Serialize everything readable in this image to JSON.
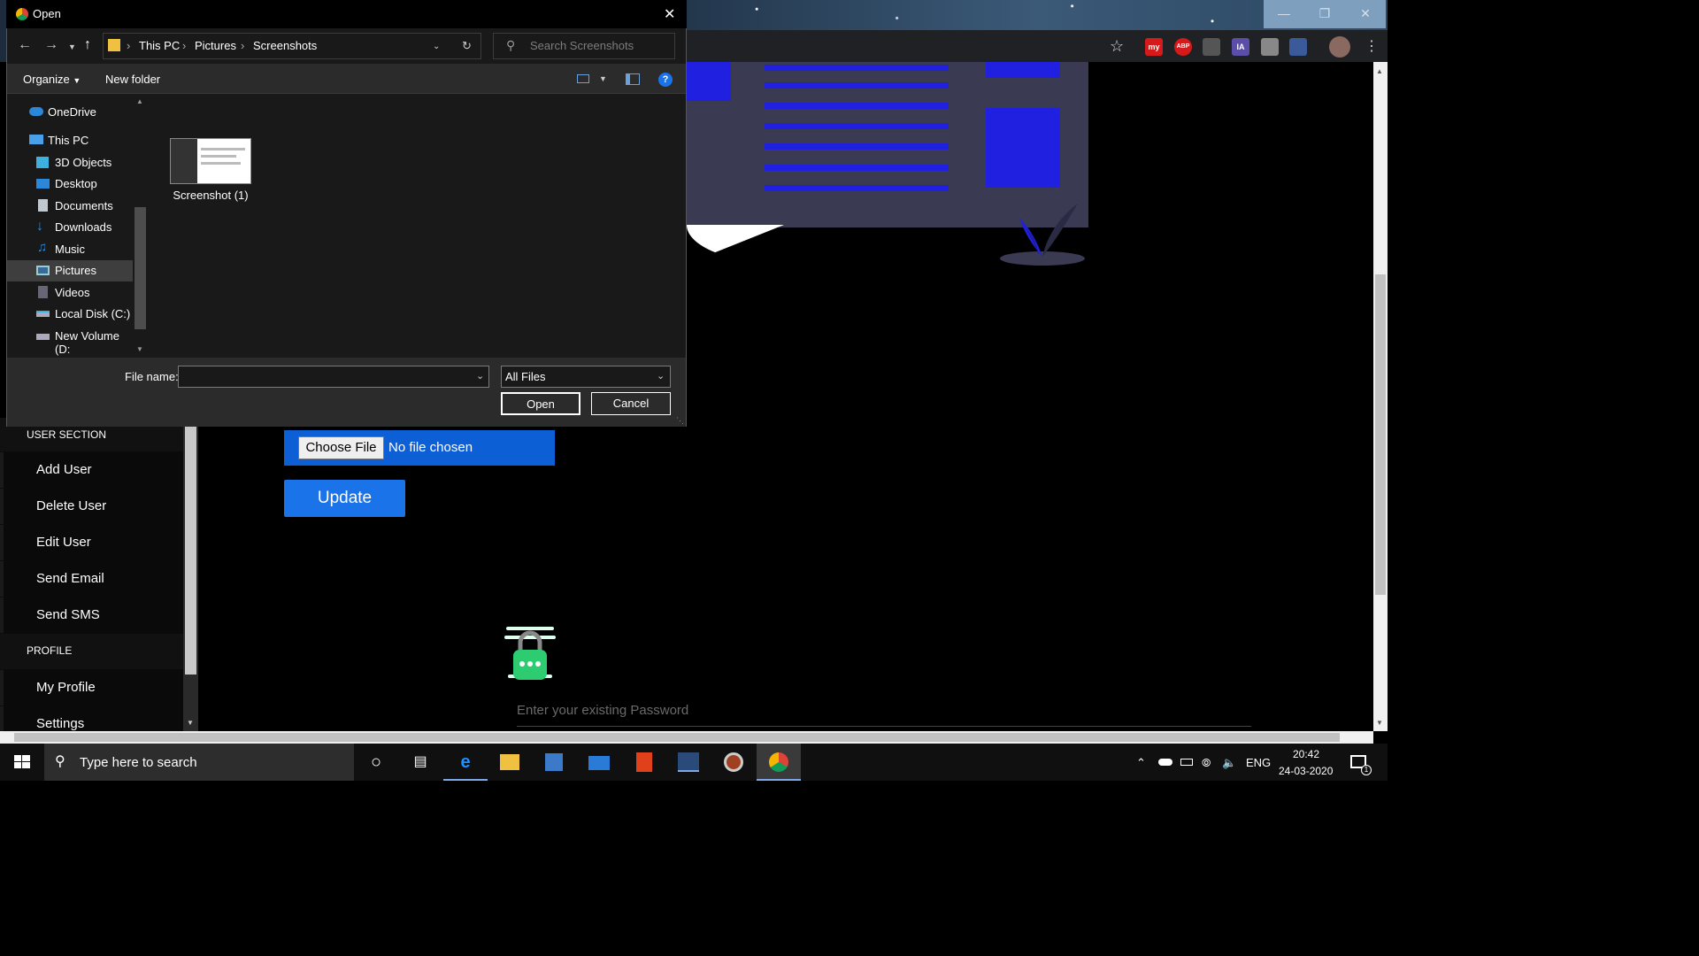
{
  "dialog": {
    "title": "Open",
    "breadcrumb": [
      "This PC",
      "Pictures",
      "Screenshots"
    ],
    "search_placeholder": "Search Screenshots",
    "toolbar": {
      "organize": "Organize",
      "new_folder": "New folder"
    },
    "nav_items": [
      {
        "label": "OneDrive"
      },
      {
        "label": "This PC"
      },
      {
        "label": "3D Objects"
      },
      {
        "label": "Desktop"
      },
      {
        "label": "Documents"
      },
      {
        "label": "Downloads"
      },
      {
        "label": "Music"
      },
      {
        "label": "Pictures",
        "selected": true
      },
      {
        "label": "Videos"
      },
      {
        "label": "Local Disk (C:)"
      },
      {
        "label": "New Volume (D:"
      }
    ],
    "files": [
      {
        "name": "Screenshot (1)"
      }
    ],
    "file_name_label": "File name:",
    "file_name_value": "",
    "file_type": "All Files",
    "open_label": "Open",
    "cancel_label": "Cancel"
  },
  "sidebar": {
    "sections": [
      {
        "title": "USER SECTION",
        "items": [
          "Add User",
          "Delete User",
          "Edit User",
          "Send Email",
          "Send SMS"
        ]
      },
      {
        "title": "PROFILE",
        "items": [
          "My Profile",
          "Settings"
        ]
      }
    ]
  },
  "form": {
    "choose_file": "Choose File",
    "no_file": "No file chosen",
    "update": "Update",
    "password_placeholder": "Enter your existing Password"
  },
  "extensions": [
    "my",
    "ABP",
    "IA"
  ],
  "taskbar": {
    "search_placeholder": "Type here to search",
    "language": "ENG",
    "time": "20:42",
    "date": "24-03-2020",
    "notification_count": "1"
  },
  "colors": {
    "accent": "#1a73e8",
    "illustration_blue": "#2020e0",
    "illustration_panel": "#3a3a52"
  }
}
